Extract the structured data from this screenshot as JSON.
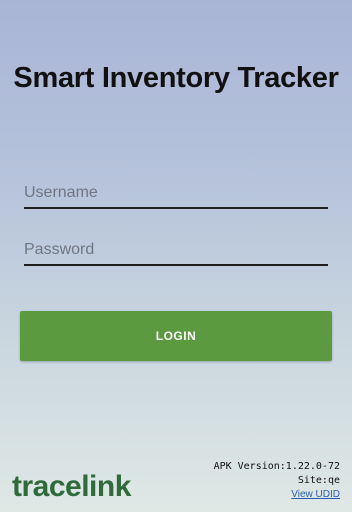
{
  "app": {
    "title": "Smart Inventory Tracker"
  },
  "form": {
    "username_placeholder": "Username",
    "username_value": "",
    "password_placeholder": "Password",
    "password_value": "",
    "login_label": "LOGIN"
  },
  "footer": {
    "logo_text": "tracelink",
    "apk_version": "APK Version:1.22.0-72",
    "site": "Site:qe",
    "view_udid_label": "View UDID"
  },
  "colors": {
    "login_button": "#5b9a3f",
    "logo": "#2f6a3b",
    "logo_accent": "#7fb244",
    "link": "#2a5db0"
  }
}
